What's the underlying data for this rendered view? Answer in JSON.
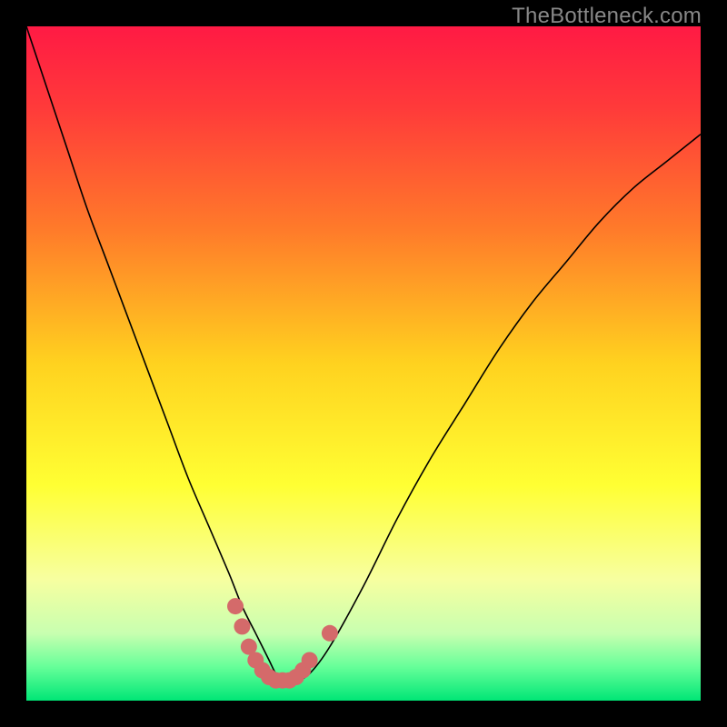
{
  "watermark": "TheBottleneck.com",
  "chart_data": {
    "type": "line",
    "title": "",
    "xlabel": "",
    "ylabel": "",
    "xlim": [
      0,
      100
    ],
    "ylim": [
      0,
      100
    ],
    "grid": false,
    "legend": false,
    "background": {
      "type": "vertical-gradient",
      "stops": [
        {
          "pos": 0.0,
          "color": "#ff1a44"
        },
        {
          "pos": 0.12,
          "color": "#ff3a3a"
        },
        {
          "pos": 0.3,
          "color": "#ff7a2a"
        },
        {
          "pos": 0.5,
          "color": "#ffd21f"
        },
        {
          "pos": 0.68,
          "color": "#ffff33"
        },
        {
          "pos": 0.82,
          "color": "#f7ffa0"
        },
        {
          "pos": 0.9,
          "color": "#c8ffb0"
        },
        {
          "pos": 0.95,
          "color": "#66ff99"
        },
        {
          "pos": 1.0,
          "color": "#00e676"
        }
      ]
    },
    "series": [
      {
        "name": "bottleneck-curve",
        "color": "#000000",
        "stroke_width": 1.6,
        "x": [
          0,
          3,
          6,
          9,
          12,
          15,
          18,
          21,
          24,
          27,
          30,
          32,
          34,
          35,
          36,
          37,
          38,
          40,
          42,
          45,
          50,
          55,
          60,
          65,
          70,
          75,
          80,
          85,
          90,
          95,
          100
        ],
        "y": [
          100,
          91,
          82,
          73,
          65,
          57,
          49,
          41,
          33,
          26,
          19,
          14,
          10,
          8,
          6,
          4,
          3,
          3,
          4,
          8,
          17,
          27,
          36,
          44,
          52,
          59,
          65,
          71,
          76,
          80,
          84
        ]
      }
    ],
    "markers": {
      "name": "minimum-region",
      "color": "#d46a6a",
      "radius": 9,
      "points": [
        {
          "x": 31,
          "y": 14
        },
        {
          "x": 32,
          "y": 11
        },
        {
          "x": 33,
          "y": 8
        },
        {
          "x": 34,
          "y": 6
        },
        {
          "x": 35,
          "y": 4.5
        },
        {
          "x": 36,
          "y": 3.5
        },
        {
          "x": 37,
          "y": 3
        },
        {
          "x": 38,
          "y": 3
        },
        {
          "x": 39,
          "y": 3
        },
        {
          "x": 40,
          "y": 3.5
        },
        {
          "x": 41,
          "y": 4.5
        },
        {
          "x": 42,
          "y": 6
        },
        {
          "x": 45,
          "y": 10
        }
      ]
    }
  }
}
